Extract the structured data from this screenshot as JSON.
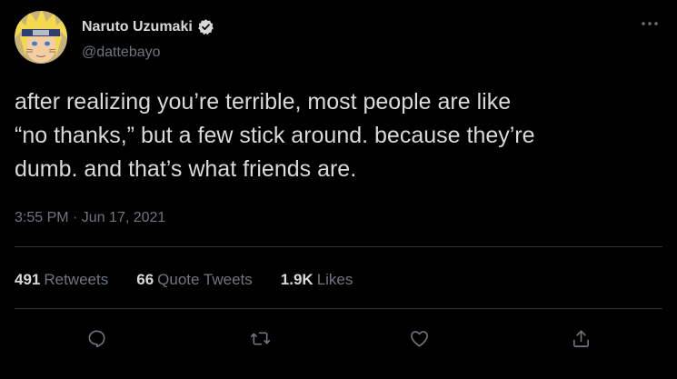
{
  "tweet": {
    "author": {
      "name": "Naruto Uzumaki",
      "handle": "@dattebayo",
      "verified": true,
      "avatar_icon": "avatar-naruto"
    },
    "text_lines": [
      "after realizing you’re terrible, most people are like",
      "“no thanks,” but a few stick around. because they’re",
      "dumb. and that’s what friends are."
    ],
    "timestamp": "3:55 PM · Jun 17, 2021",
    "stats": {
      "retweets": {
        "count": "491",
        "label": "Retweets"
      },
      "quotes": {
        "count": "66",
        "label": "Quote Tweets"
      },
      "likes": {
        "count": "1.9K",
        "label": "Likes"
      }
    },
    "actions": [
      "reply-icon",
      "retweet-icon",
      "like-icon",
      "share-icon"
    ],
    "more_icon": "more-icon"
  },
  "colors": {
    "background": "#000000",
    "text": "#d9d9d9",
    "muted": "#6e767d",
    "divider": "#2f3336",
    "verified": "#d9d9d9"
  }
}
